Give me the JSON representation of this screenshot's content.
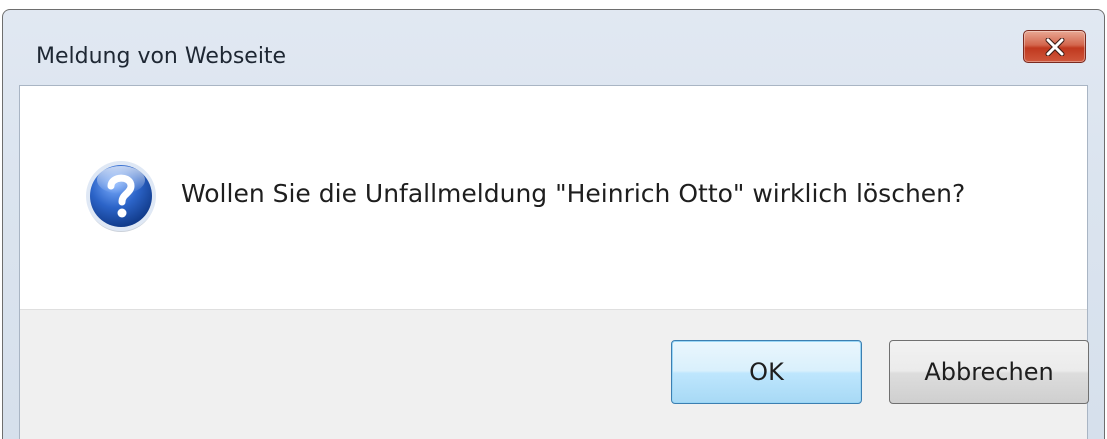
{
  "dialog": {
    "title": "Meldung von Webseite",
    "close_icon": "close-icon",
    "message_icon": "question-icon",
    "message": "Wollen Sie die Unfallmeldung \"Heinrich Otto\" wirklich löschen?",
    "buttons": {
      "ok_label": "OK",
      "cancel_label": "Abbrechen"
    }
  },
  "colors": {
    "close_button": "#c7462b",
    "icon_blue": "#2c64c8",
    "default_button_border": "#3c7fb1",
    "button_area": "#f0f0f0"
  }
}
